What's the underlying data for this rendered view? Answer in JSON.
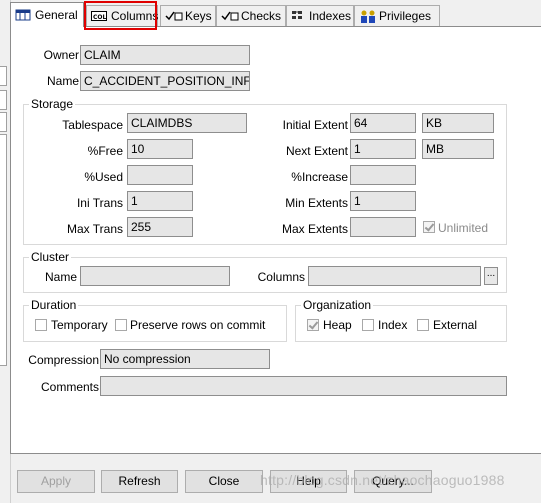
{
  "tabs": [
    {
      "label": "General",
      "icon": "table-icon"
    },
    {
      "label": "Columns",
      "icon": "col-icon"
    },
    {
      "label": "Keys",
      "icon": "key-check-icon"
    },
    {
      "label": "Checks",
      "icon": "check-icon"
    },
    {
      "label": "Indexes",
      "icon": "index-icon"
    },
    {
      "label": "Privileges",
      "icon": "users-icon"
    }
  ],
  "general": {
    "owner_label": "Owner",
    "owner_value": "CLAIM",
    "name_label": "Name",
    "name_value": "C_ACCIDENT_POSITION_INFO"
  },
  "storage": {
    "title": "Storage",
    "tablespace_label": "Tablespace",
    "tablespace_value": "CLAIMDBS",
    "free_label": "%Free",
    "free_value": "10",
    "used_label": "%Used",
    "used_value": "",
    "ini_trans_label": "Ini Trans",
    "ini_trans_value": "1",
    "max_trans_label": "Max Trans",
    "max_trans_value": "255",
    "initial_extent_label": "Initial Extent",
    "initial_extent_value": "64",
    "initial_extent_unit": "KB",
    "next_extent_label": "Next Extent",
    "next_extent_value": "1",
    "next_extent_unit": "MB",
    "increase_label": "%Increase",
    "increase_value": "",
    "min_extents_label": "Min Extents",
    "min_extents_value": "1",
    "max_extents_label": "Max Extents",
    "max_extents_value": "",
    "unlimited_label": "Unlimited",
    "unlimited_checked": true
  },
  "cluster": {
    "title": "Cluster",
    "name_label": "Name",
    "name_value": "",
    "columns_label": "Columns",
    "columns_value": "",
    "browse_label": "..."
  },
  "duration": {
    "title": "Duration",
    "temporary_label": "Temporary",
    "preserve_label": "Preserve rows on commit"
  },
  "organization": {
    "title": "Organization",
    "heap_label": "Heap",
    "index_label": "Index",
    "external_label": "External"
  },
  "compression": {
    "label": "Compression",
    "value": "No compression"
  },
  "comments": {
    "label": "Comments",
    "value": ""
  },
  "buttons": {
    "apply": "Apply",
    "refresh": "Refresh",
    "close": "Close",
    "help": "Help",
    "query": "Query..."
  },
  "watermark": "http://blog.csdn.net/zhaochaoguo1988"
}
